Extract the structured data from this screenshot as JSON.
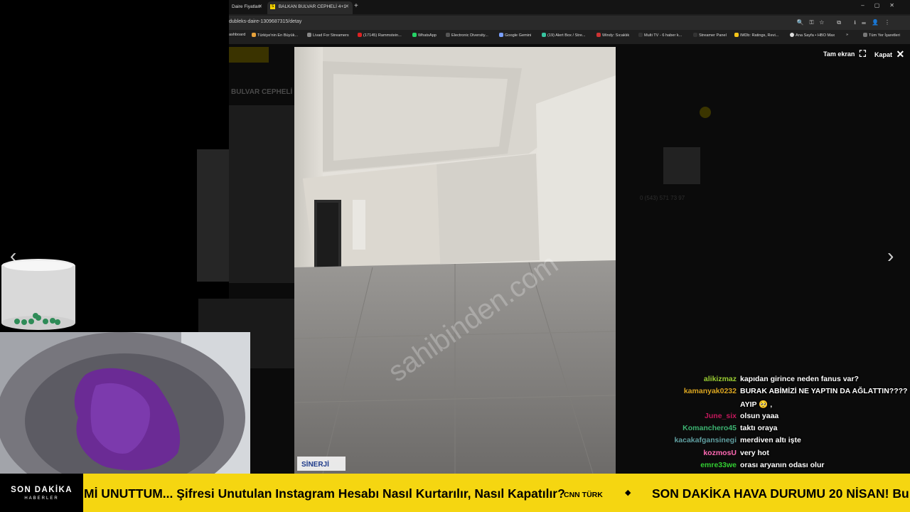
{
  "browser": {
    "tabs": [
      {
        "label": "Daire Fiyatları"
      },
      {
        "label": "BALKAN BULVAR CEPHELİ 4+1",
        "favicon": "S"
      }
    ],
    "url": "dubleks-daire-1309687315/detay",
    "bookmarks": [
      "ashboard",
      "Türkiye'nin En Büyük...",
      "Livad For Streamers",
      "(17145) Rammstein...",
      "WhatsApp",
      "Electronic Diversity...",
      "Google Gemini",
      "(19) Alert Box / Stre...",
      "Windy: Sıcaklık",
      "Multi TV - 6 haber k...",
      "Streamer Panel",
      "IMDb: Ratings, Revi...",
      "Ana Sayfa • HBO Max",
      "Tüm Yer İşaretleri"
    ]
  },
  "page": {
    "title": "BULVAR CEPHELİ",
    "phone": "0 (543) 571 73 97"
  },
  "lightbox": {
    "fullscreen_label": "Tam ekran",
    "close_label": "Kapat",
    "watermark": "sahibinden.com",
    "logo": "SİNERJİ"
  },
  "chat": [
    {
      "user": "alikizmaz",
      "text": "kapıdan girince neden fanus var?",
      "color": "#9ACD32"
    },
    {
      "user": "kamanyak0232",
      "text": "BURAK ABİMİZİ NE YAPTIN DA AĞLATTIN????",
      "color": "#DAA520"
    },
    {
      "user": "",
      "text": "AYIP 🥺 ,",
      "color": "#ffffff"
    },
    {
      "user": "June_six",
      "text": "olsun yaaa",
      "color": "#C2185B"
    },
    {
      "user": "Komanchero45",
      "text": "taktı oraya",
      "color": "#3CB371"
    },
    {
      "user": "kacakafgansinegi",
      "text": "merdiven altı işte",
      "color": "#5F9EA0"
    },
    {
      "user": "kozmosU",
      "text": "very hot",
      "color": "#FF69B4"
    },
    {
      "user": "emre33we",
      "text": "orası aryanın odası olur",
      "color": "#32CD32"
    }
  ],
  "ticker": {
    "brand": "SON DAKİKA",
    "brand_sub": "HABERLER",
    "item1": "Mİ UNUTTUM... Şifresi Unutulan Instagram Hesabı Nasıl Kurtarılır, Nasıl Kapatılır?",
    "source1": "CNN TÜRK",
    "separator": "◆",
    "item2": "SON DAKİKA HAVA DURUMU 20 NİSAN! Bu"
  }
}
